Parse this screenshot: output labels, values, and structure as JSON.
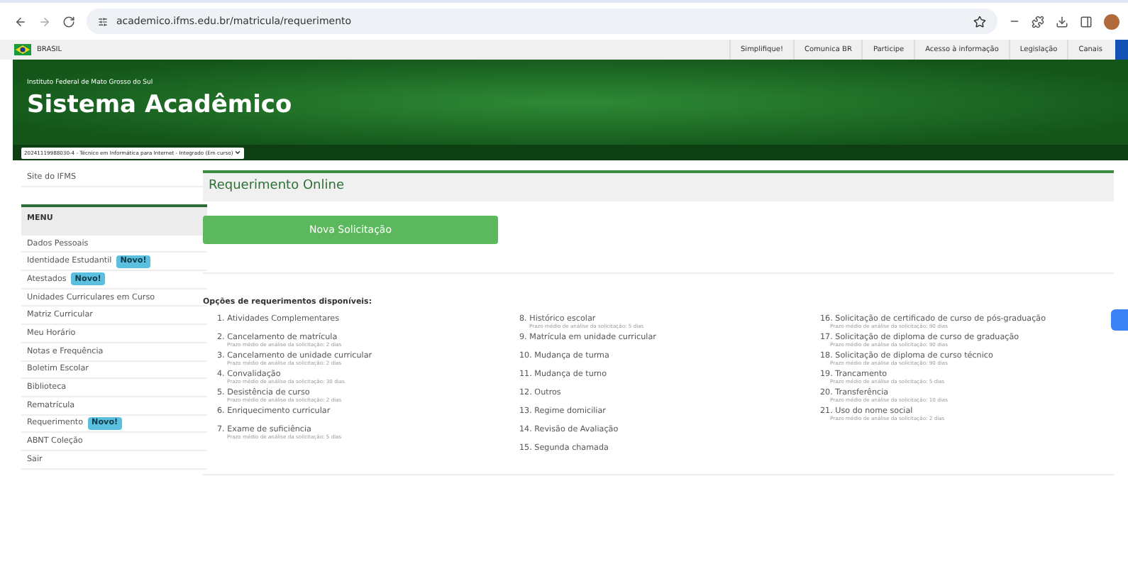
{
  "browser": {
    "url": "academico.ifms.edu.br/matricula/requerimento"
  },
  "gov_bar": {
    "country": "BRASIL",
    "links": [
      "Simplifique!",
      "Comunica BR",
      "Participe",
      "Acesso à informação",
      "Legislação",
      "Canais"
    ]
  },
  "header": {
    "institution": "Instituto Federal de Mato Grosso do Sul",
    "title": "Sistema Acadêmico",
    "course_select": "20241119988030-4 - Técnico em Informática para Internet - Integrado (Em curso)"
  },
  "sidebar": {
    "site_link": "Site do IFMS",
    "menu_title": "MENU",
    "items": [
      {
        "label": "Dados Pessoais"
      },
      {
        "label": "Identidade Estudantil",
        "badge": "Novo!"
      },
      {
        "label": "Atestados",
        "badge": "Novo!"
      },
      {
        "label": "Unidades Curriculares em Curso"
      },
      {
        "label": "Matriz Curricular"
      },
      {
        "label": "Meu Horário"
      },
      {
        "label": "Notas e Frequência"
      },
      {
        "label": "Boletim Escolar"
      },
      {
        "label": "Biblioteca"
      },
      {
        "label": "Rematrícula"
      },
      {
        "label": "Requerimento",
        "badge": "Novo!"
      },
      {
        "label": "ABNT Coleção"
      },
      {
        "label": "Sair"
      }
    ]
  },
  "main": {
    "title": "Requerimento Online",
    "new_button": "Nova Solicitação",
    "options_title": "Opções de requerimentos disponíveis:",
    "columns": [
      [
        {
          "label": "1. Atividades Complementares"
        },
        {
          "label": "2. Cancelamento de matrícula",
          "deadline": "Prazo médio de análise da solicitação: 2 dias"
        },
        {
          "label": "3. Cancelamento de unidade curricular",
          "deadline": "Prazo médio de análise da solicitação: 2 dias"
        },
        {
          "label": "4. Convalidação",
          "deadline": "Prazo médio de análise da solicitação: 30 dias"
        },
        {
          "label": "5. Desistência de curso",
          "deadline": "Prazo médio de análise da solicitação: 2 dias"
        },
        {
          "label": "6. Enriquecimento curricular"
        },
        {
          "label": "7. Exame de suficiência",
          "deadline": "Prazo médio de análise da solicitação: 5 dias"
        }
      ],
      [
        {
          "label": "8. Histórico escolar",
          "deadline": "Prazo médio de análise da solicitação: 5 dias"
        },
        {
          "label": "9. Matrícula em unidade curricular"
        },
        {
          "label": "10. Mudança de turma"
        },
        {
          "label": "11. Mudança de turno"
        },
        {
          "label": "12. Outros"
        },
        {
          "label": "13. Regime domiciliar"
        },
        {
          "label": "14. Revisão de Avaliação"
        },
        {
          "label": "15. Segunda chamada"
        }
      ],
      [
        {
          "label": "16. Solicitação de certificado de curso de pós-graduação",
          "deadline": "Prazo médio de análise da solicitação: 90 dias"
        },
        {
          "label": "17. Solicitação de diploma de curso de graduação",
          "deadline": "Prazo médio de análise da solicitação: 90 dias"
        },
        {
          "label": "18. Solicitação de diploma de curso técnico",
          "deadline": "Prazo médio de análise da solicitação: 90 dias"
        },
        {
          "label": "19. Trancamento",
          "deadline": "Prazo médio de análise da solicitação: 5 dias"
        },
        {
          "label": "20. Transferência",
          "deadline": "Prazo médio de análise da solicitação: 10 dias"
        },
        {
          "label": "21. Uso do nome social",
          "deadline": "Prazo médio de análise da solicitação: 2 dias"
        }
      ]
    ]
  }
}
